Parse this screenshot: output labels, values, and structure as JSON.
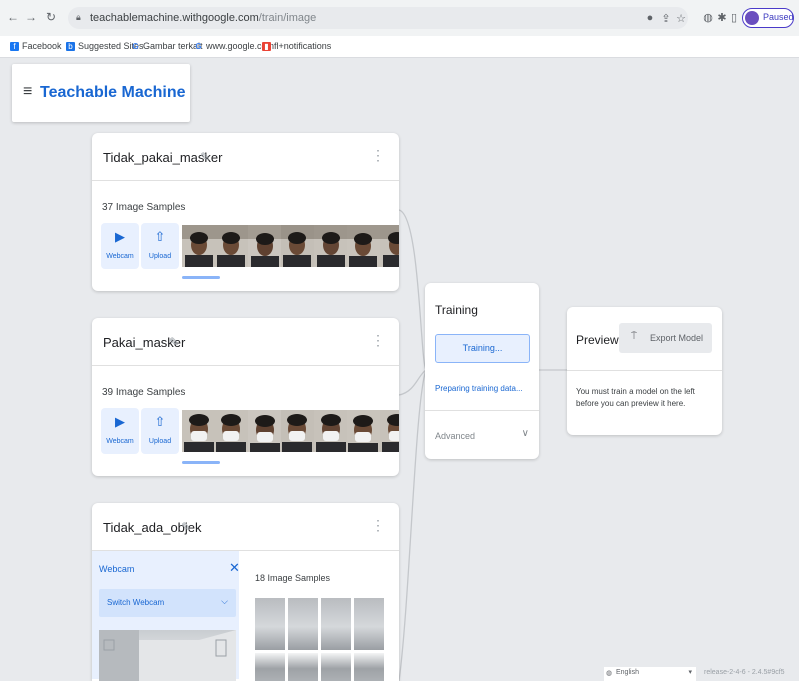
{
  "browser": {
    "url_domain": "teachablemachine.withgoogle.com",
    "url_path": "/train/image",
    "profile_label": "Paused",
    "icons": [
      "back-icon",
      "forward-icon",
      "reload-icon",
      "lock-icon",
      "extension-icon",
      "share-icon",
      "star-icon",
      "puzzle-icon",
      "pin-icon",
      "sidebar-icon"
    ]
  },
  "bookmarks": [
    {
      "label": "Facebook",
      "icon_color": "#1877f2",
      "icon": "F"
    },
    {
      "label": "Suggested Sites",
      "icon_color": "#1a73e8",
      "icon": "b"
    },
    {
      "label": "Gambar terkait",
      "icon_color": "#4285f4",
      "icon": "G"
    },
    {
      "label": "www.google.com",
      "icon_color": "#4285f4",
      "icon": "G"
    },
    {
      "label": "fl+notifications",
      "icon_color": "#ea4335",
      "icon": "▮"
    }
  ],
  "app": {
    "title": "Teachable Machine",
    "accent": "#1967d2"
  },
  "classes": [
    {
      "name": "Tidak_pakai_masker",
      "samples": "37 Image Samples"
    },
    {
      "name": "Pakai_masker",
      "samples": "39 Image Samples"
    },
    {
      "name": "Tidak_ada_objek",
      "samples": "18 Image Samples"
    }
  ],
  "tools": {
    "webcam": "Webcam",
    "upload": "Upload"
  },
  "webcam_panel": {
    "label": "Webcam",
    "switch_label": "Switch Webcam"
  },
  "training": {
    "title": "Training",
    "button": "Training...",
    "status": "Preparing training data...",
    "advanced": "Advanced"
  },
  "preview": {
    "title": "Preview",
    "export": "Export Model",
    "message": "You must train a model on the left before you can preview it here."
  },
  "footer": {
    "language": "English",
    "release": "release-2-4-6 - 2.4.5#9cf5"
  }
}
